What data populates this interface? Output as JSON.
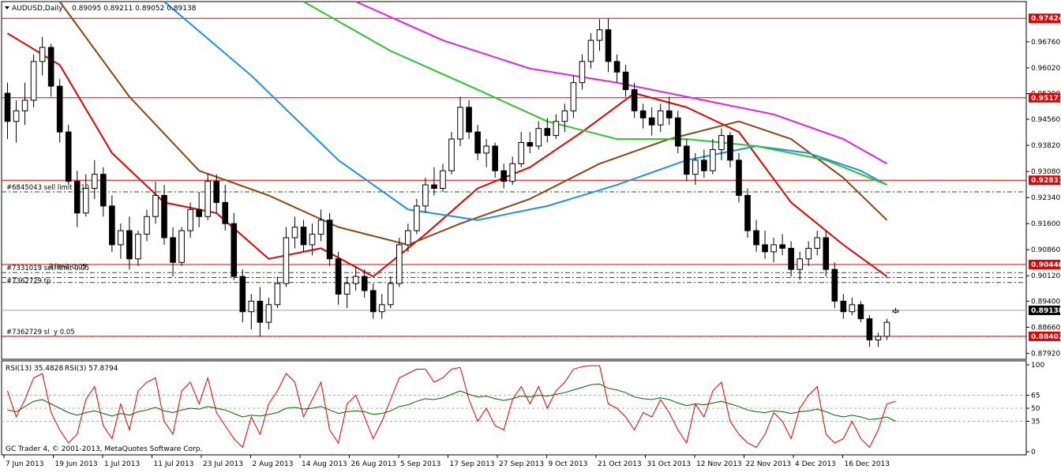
{
  "window": {
    "symbol_title": "AUDUSD,Daily",
    "ohlc": "0.89095 0.89211 0.89052 0.89138",
    "copyright": "GC Trader 4, © 2001-2013, MetaQuotes Software Corp."
  },
  "price_axis": {
    "ticks": [
      "0.96760",
      "0.96020",
      "0.95290",
      "0.94560",
      "0.93820",
      "0.93080",
      "0.92340",
      "0.91600",
      "0.90860",
      "0.90120",
      "0.89400",
      "0.88660",
      "0.87920"
    ],
    "tags": [
      {
        "label": "0.97424",
        "value": 0.97424,
        "color": "#e00000"
      },
      {
        "label": "0.95171",
        "value": 0.95171,
        "color": "#e00000"
      },
      {
        "label": "0.92831",
        "value": 0.92831,
        "color": "#e00000"
      },
      {
        "label": "0.90440",
        "value": 0.9044,
        "color": "#e00000"
      },
      {
        "label": "0.89138",
        "value": 0.89138,
        "color": "#000000"
      },
      {
        "label": "0.88402",
        "value": 0.88402,
        "color": "#e00000"
      }
    ]
  },
  "date_axis": {
    "labels": [
      "7 Jun 2013",
      "19 Jun 2013",
      "1 Jul 2013",
      "11 Jul 2013",
      "23 Jul 2013",
      "2 Aug 2013",
      "14 Aug 2013",
      "26 Aug 2013",
      "5 Sep 2013",
      "17 Sep 2013",
      "27 Sep 2013",
      "9 Oct 2013",
      "21 Oct 2013",
      "31 Oct 2013",
      "12 Nov 2013",
      "22 Nov 2013",
      "4 Dec 2013",
      "16 Dec 2013"
    ]
  },
  "orders": [
    {
      "label": "#6845043 sell limit 0.10",
      "value": 0.925,
      "color": "#007000"
    },
    {
      "label": "#7331019 sell limit 0.05",
      "value": 0.9021,
      "color": "#007000"
    },
    {
      "label": "#7362729 tp",
      "value": 0.8993,
      "color": "#007000"
    },
    {
      "label": "ll limit 0.05",
      "value": 0.9007,
      "color": "#007000"
    },
    {
      "label": "#7362729 sl",
      "value": 0.884,
      "color": "#e00000"
    },
    {
      "label": "y 0.05",
      "value": 0.884,
      "color": "#e00000"
    }
  ],
  "rsi_panel": {
    "title_rsi13": "RSI(13) 35.4828",
    "title_rsi3": "RSI(3) 57.8794",
    "levels": [
      "100",
      "65",
      "50",
      "35",
      "0"
    ],
    "rsi13_color": "#006400",
    "rsi3_color": "#e00000"
  },
  "colors": {
    "bull_candle": "#ffffff",
    "bear_candle": "#000000",
    "ma_red": "#e00000",
    "ma_brown": "#8b4513",
    "ma_blue": "#1e8fe6",
    "ma_green": "#2ec42e",
    "ma_magenta": "#e020e0",
    "resistance_line": "#e00000"
  },
  "chart_data": {
    "type": "candlestick",
    "symbol": "AUDUSD",
    "timeframe": "Daily",
    "ylim": [
      0.8775,
      0.979
    ],
    "horizontal_levels": [
      0.97424,
      0.95171,
      0.92831,
      0.9044,
      0.88402
    ],
    "current_price": 0.89138,
    "candles": [
      [
        0.953,
        0.956,
        0.94,
        0.945
      ],
      [
        0.945,
        0.951,
        0.939,
        0.948
      ],
      [
        0.948,
        0.956,
        0.944,
        0.951
      ],
      [
        0.951,
        0.964,
        0.949,
        0.962
      ],
      [
        0.962,
        0.969,
        0.958,
        0.966
      ],
      [
        0.966,
        0.967,
        0.952,
        0.955
      ],
      [
        0.955,
        0.957,
        0.939,
        0.942
      ],
      [
        0.942,
        0.944,
        0.927,
        0.928
      ],
      [
        0.928,
        0.931,
        0.915,
        0.919
      ],
      [
        0.919,
        0.93,
        0.918,
        0.926
      ],
      [
        0.926,
        0.934,
        0.923,
        0.93
      ],
      [
        0.93,
        0.932,
        0.918,
        0.921
      ],
      [
        0.921,
        0.924,
        0.908,
        0.91
      ],
      [
        0.91,
        0.916,
        0.906,
        0.914
      ],
      [
        0.914,
        0.918,
        0.903,
        0.906
      ],
      [
        0.906,
        0.914,
        0.904,
        0.913
      ],
      [
        0.913,
        0.92,
        0.911,
        0.918
      ],
      [
        0.918,
        0.928,
        0.916,
        0.924
      ],
      [
        0.924,
        0.927,
        0.91,
        0.912
      ],
      [
        0.912,
        0.915,
        0.901,
        0.905
      ],
      [
        0.905,
        0.915,
        0.904,
        0.914
      ],
      [
        0.914,
        0.922,
        0.912,
        0.92
      ],
      [
        0.92,
        0.925,
        0.915,
        0.918
      ],
      [
        0.918,
        0.93,
        0.917,
        0.928
      ],
      [
        0.928,
        0.93,
        0.919,
        0.922
      ],
      [
        0.922,
        0.927,
        0.914,
        0.916
      ],
      [
        0.916,
        0.919,
        0.9,
        0.901
      ],
      [
        0.901,
        0.903,
        0.888,
        0.891
      ],
      [
        0.891,
        0.896,
        0.886,
        0.894
      ],
      [
        0.894,
        0.898,
        0.884,
        0.888
      ],
      [
        0.888,
        0.895,
        0.886,
        0.893
      ],
      [
        0.893,
        0.901,
        0.892,
        0.899
      ],
      [
        0.899,
        0.915,
        0.898,
        0.912
      ],
      [
        0.912,
        0.918,
        0.909,
        0.915
      ],
      [
        0.915,
        0.917,
        0.908,
        0.91
      ],
      [
        0.91,
        0.916,
        0.907,
        0.913
      ],
      [
        0.913,
        0.92,
        0.911,
        0.917
      ],
      [
        0.917,
        0.919,
        0.904,
        0.906
      ],
      [
        0.906,
        0.908,
        0.893,
        0.896
      ],
      [
        0.896,
        0.901,
        0.892,
        0.899
      ],
      [
        0.899,
        0.904,
        0.897,
        0.901
      ],
      [
        0.901,
        0.903,
        0.895,
        0.897
      ],
      [
        0.897,
        0.899,
        0.889,
        0.891
      ],
      [
        0.891,
        0.896,
        0.889,
        0.893
      ],
      [
        0.893,
        0.901,
        0.892,
        0.899
      ],
      [
        0.899,
        0.912,
        0.898,
        0.91
      ],
      [
        0.91,
        0.916,
        0.908,
        0.914
      ],
      [
        0.914,
        0.923,
        0.913,
        0.921
      ],
      [
        0.921,
        0.929,
        0.919,
        0.927
      ],
      [
        0.927,
        0.932,
        0.924,
        0.926
      ],
      [
        0.926,
        0.933,
        0.925,
        0.931
      ],
      [
        0.931,
        0.942,
        0.93,
        0.94
      ],
      [
        0.94,
        0.952,
        0.938,
        0.949
      ],
      [
        0.949,
        0.951,
        0.94,
        0.942
      ],
      [
        0.942,
        0.944,
        0.934,
        0.936
      ],
      [
        0.936,
        0.94,
        0.932,
        0.938
      ],
      [
        0.938,
        0.939,
        0.929,
        0.931
      ],
      [
        0.931,
        0.933,
        0.926,
        0.928
      ],
      [
        0.928,
        0.935,
        0.927,
        0.933
      ],
      [
        0.933,
        0.942,
        0.932,
        0.939
      ],
      [
        0.939,
        0.942,
        0.936,
        0.938
      ],
      [
        0.938,
        0.945,
        0.937,
        0.943
      ],
      [
        0.943,
        0.946,
        0.939,
        0.941
      ],
      [
        0.941,
        0.947,
        0.94,
        0.945
      ],
      [
        0.945,
        0.95,
        0.942,
        0.948
      ],
      [
        0.948,
        0.958,
        0.946,
        0.956
      ],
      [
        0.956,
        0.964,
        0.954,
        0.962
      ],
      [
        0.962,
        0.97,
        0.96,
        0.968
      ],
      [
        0.968,
        0.974,
        0.965,
        0.971
      ],
      [
        0.971,
        0.9742,
        0.959,
        0.962
      ],
      [
        0.962,
        0.964,
        0.956,
        0.959
      ],
      [
        0.959,
        0.961,
        0.952,
        0.954
      ],
      [
        0.954,
        0.956,
        0.946,
        0.948
      ],
      [
        0.948,
        0.95,
        0.943,
        0.946
      ],
      [
        0.946,
        0.949,
        0.941,
        0.944
      ],
      [
        0.944,
        0.95,
        0.942,
        0.948
      ],
      [
        0.948,
        0.952,
        0.944,
        0.946
      ],
      [
        0.946,
        0.948,
        0.936,
        0.938
      ],
      [
        0.938,
        0.94,
        0.928,
        0.93
      ],
      [
        0.93,
        0.936,
        0.927,
        0.934
      ],
      [
        0.934,
        0.937,
        0.929,
        0.931
      ],
      [
        0.931,
        0.94,
        0.93,
        0.937
      ],
      [
        0.937,
        0.943,
        0.934,
        0.941
      ],
      [
        0.941,
        0.942,
        0.932,
        0.934
      ],
      [
        0.934,
        0.936,
        0.922,
        0.924
      ],
      [
        0.924,
        0.926,
        0.912,
        0.914
      ],
      [
        0.914,
        0.917,
        0.908,
        0.91
      ],
      [
        0.91,
        0.914,
        0.906,
        0.908
      ],
      [
        0.908,
        0.912,
        0.905,
        0.91
      ],
      [
        0.91,
        0.913,
        0.907,
        0.909
      ],
      [
        0.909,
        0.911,
        0.901,
        0.903
      ],
      [
        0.903,
        0.908,
        0.9,
        0.906
      ],
      [
        0.906,
        0.911,
        0.904,
        0.909
      ],
      [
        0.909,
        0.914,
        0.907,
        0.912
      ],
      [
        0.912,
        0.914,
        0.901,
        0.903
      ],
      [
        0.903,
        0.905,
        0.892,
        0.894
      ],
      [
        0.894,
        0.896,
        0.889,
        0.891
      ],
      [
        0.891,
        0.895,
        0.89,
        0.893
      ],
      [
        0.893,
        0.894,
        0.888,
        0.889
      ],
      [
        0.889,
        0.89,
        0.881,
        0.883
      ],
      [
        0.883,
        0.885,
        0.881,
        0.884
      ],
      [
        0.884,
        0.889,
        0.883,
        0.888
      ],
      [
        0.8909,
        0.8921,
        0.8905,
        0.8914
      ]
    ],
    "moving_averages": [
      {
        "color": "#e00000",
        "points": [
          [
            0,
            0.97
          ],
          [
            6,
            0.961
          ],
          [
            12,
            0.936
          ],
          [
            18,
            0.922
          ],
          [
            24,
            0.919
          ],
          [
            30,
            0.906
          ],
          [
            36,
            0.909
          ],
          [
            42,
            0.901
          ],
          [
            48,
            0.913
          ],
          [
            54,
            0.926
          ],
          [
            60,
            0.932
          ],
          [
            66,
            0.942
          ],
          [
            72,
            0.953
          ],
          [
            78,
            0.949
          ],
          [
            84,
            0.942
          ],
          [
            90,
            0.922
          ],
          [
            96,
            0.91
          ],
          [
            101,
            0.901
          ]
        ]
      },
      {
        "color": "#8b4513",
        "points": [
          [
            6,
            0.979
          ],
          [
            14,
            0.952
          ],
          [
            22,
            0.931
          ],
          [
            30,
            0.924
          ],
          [
            38,
            0.915
          ],
          [
            46,
            0.91
          ],
          [
            52,
            0.916
          ],
          [
            60,
            0.923
          ],
          [
            68,
            0.933
          ],
          [
            76,
            0.94
          ],
          [
            84,
            0.945
          ],
          [
            90,
            0.94
          ],
          [
            96,
            0.929
          ],
          [
            101,
            0.917
          ]
        ]
      },
      {
        "color": "#1e8fe6",
        "points": [
          [
            18,
            0.979
          ],
          [
            28,
            0.958
          ],
          [
            38,
            0.934
          ],
          [
            46,
            0.92
          ],
          [
            54,
            0.917
          ],
          [
            62,
            0.921
          ],
          [
            70,
            0.927
          ],
          [
            78,
            0.934
          ],
          [
            86,
            0.938
          ],
          [
            92,
            0.936
          ],
          [
            98,
            0.931
          ],
          [
            101,
            0.927
          ]
        ]
      },
      {
        "color": "#2ec42e",
        "points": [
          [
            34,
            0.979
          ],
          [
            44,
            0.965
          ],
          [
            54,
            0.954
          ],
          [
            62,
            0.945
          ],
          [
            70,
            0.94
          ],
          [
            78,
            0.94
          ],
          [
            86,
            0.938
          ],
          [
            94,
            0.934
          ],
          [
            101,
            0.927
          ]
        ]
      },
      {
        "color": "#e020e0",
        "points": [
          [
            40,
            0.979
          ],
          [
            50,
            0.968
          ],
          [
            60,
            0.96
          ],
          [
            70,
            0.956
          ],
          [
            80,
            0.951
          ],
          [
            88,
            0.947
          ],
          [
            96,
            0.94
          ],
          [
            101,
            0.933
          ]
        ]
      }
    ],
    "rsi13": [
      48,
      46,
      52,
      58,
      60,
      55,
      50,
      45,
      42,
      45,
      47,
      44,
      41,
      44,
      42,
      46,
      48,
      51,
      47,
      45,
      48,
      50,
      49,
      52,
      50,
      48,
      44,
      40,
      42,
      41,
      43,
      45,
      50,
      51,
      49,
      50,
      52,
      48,
      44,
      46,
      47,
      46,
      43,
      44,
      47,
      52,
      54,
      58,
      61,
      60,
      62,
      66,
      70,
      66,
      63,
      64,
      61,
      59,
      61,
      64,
      63,
      65,
      64,
      66,
      68,
      71,
      74,
      77,
      78,
      73,
      71,
      68,
      63,
      61,
      60,
      62,
      60,
      56,
      53,
      55,
      54,
      56,
      58,
      55,
      52,
      48,
      46,
      45,
      47,
      46,
      44,
      46,
      47,
      49,
      46,
      42,
      40,
      42,
      40,
      37,
      38,
      40,
      35
    ],
    "rsi3": [
      70,
      40,
      60,
      85,
      90,
      45,
      25,
      10,
      20,
      60,
      75,
      30,
      15,
      55,
      25,
      70,
      80,
      85,
      35,
      20,
      70,
      80,
      55,
      85,
      45,
      30,
      15,
      5,
      40,
      20,
      55,
      70,
      90,
      80,
      40,
      60,
      80,
      25,
      10,
      55,
      65,
      40,
      15,
      35,
      60,
      85,
      90,
      95,
      95,
      80,
      85,
      95,
      97,
      60,
      35,
      50,
      30,
      25,
      60,
      75,
      55,
      75,
      50,
      70,
      80,
      95,
      98,
      99,
      99,
      55,
      50,
      40,
      25,
      45,
      40,
      60,
      45,
      25,
      10,
      55,
      40,
      70,
      80,
      35,
      20,
      10,
      5,
      20,
      45,
      35,
      15,
      50,
      65,
      75,
      20,
      10,
      15,
      35,
      15,
      5,
      25,
      55,
      58
    ]
  }
}
